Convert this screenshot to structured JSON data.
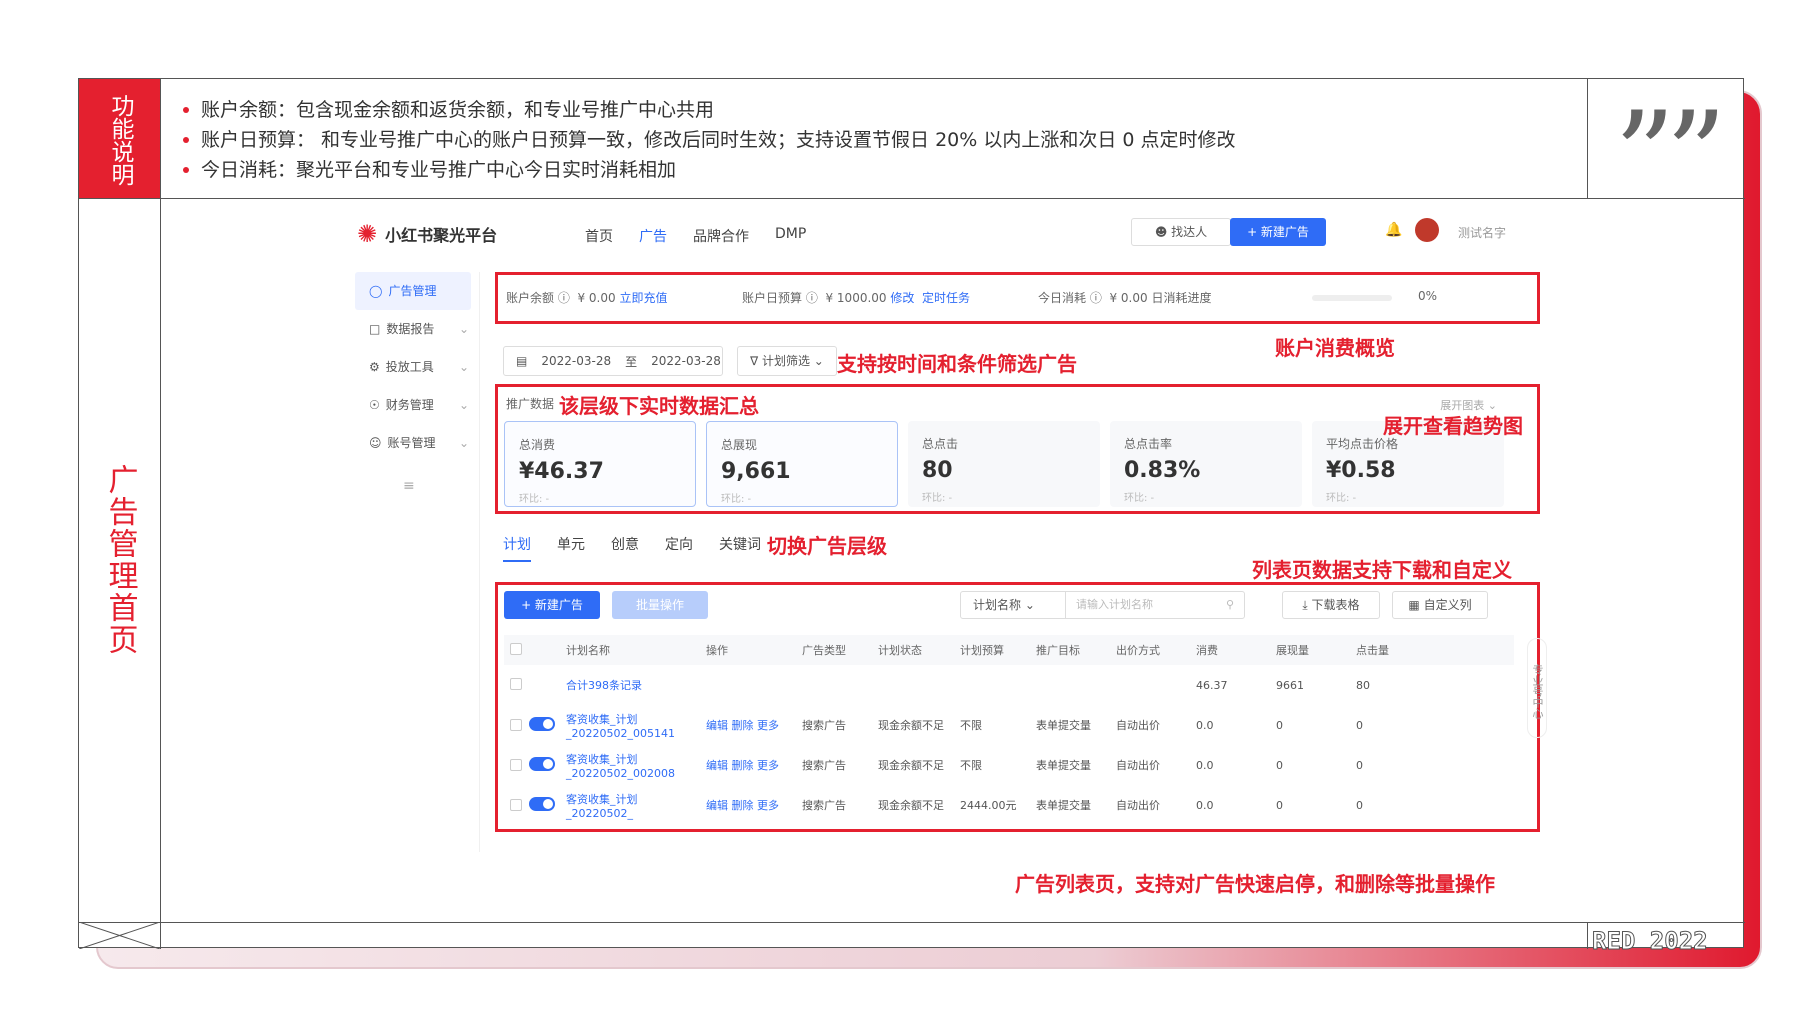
{
  "header": {
    "section_label": "功能说明",
    "bullets": [
      "账户余额：包含现金余额和返货余额，和专业号推广中心共用",
      "账户日预算：  和专业号推广中心的账户日预算一致，修改后同时生效；支持设置节假日 20% 以内上涨和次日 0 点定时修改",
      "今日消耗：聚光平台和专业号推广中心今日实时消耗相加"
    ]
  },
  "side_title": "广告管理首页",
  "footer_tag": "RED 2022",
  "annotations": {
    "overview": "账户消费概览",
    "filter": "支持按时间和条件筛选广告",
    "summary": "该层级下实时数据汇总",
    "trend": "展开查看趋势图",
    "level": "切换广告层级",
    "list_dl": "列表页数据支持下载和自定义",
    "list_ops": "广告列表页，支持对广告快速启停，和删除等批量操作"
  },
  "app": {
    "brand": "小红书聚光平台",
    "nav": [
      "首页",
      "广告",
      "品牌合作",
      "DMP"
    ],
    "find_btn": "找达人",
    "new_btn": "+ 新建广告",
    "user": "测试名字",
    "sidebar": [
      "广告管理",
      "数据报告",
      "投放工具",
      "财务管理",
      "账号管理"
    ],
    "overview": {
      "balance_label": "账户余额",
      "balance": "¥ 0.00",
      "recharge": "立即充值",
      "budget_label": "账户日预算",
      "budget": "¥ 1000.00",
      "modify": "修改",
      "timed": "定时任务",
      "today_label": "今日消耗",
      "today": "¥ 0.00",
      "progress_label": "日消耗进度",
      "progress_pct": "0%"
    },
    "filter": {
      "date_from": "2022-03-28",
      "to": "至",
      "date_to": "2022-03-28",
      "plan_filter": "计划筛选"
    },
    "stats": {
      "label": "推广数据",
      "expand": "展开图表",
      "cards": [
        {
          "title": "总消费",
          "value": "¥46.37",
          "sub": "环比: -"
        },
        {
          "title": "总展现",
          "value": "9,661",
          "sub": "环比: -"
        },
        {
          "title": "总点击",
          "value": "80",
          "sub": "环比: -"
        },
        {
          "title": "总点击率",
          "value": "0.83%",
          "sub": "环比: -"
        },
        {
          "title": "平均点击价格",
          "value": "¥0.58",
          "sub": "环比: -"
        }
      ]
    },
    "tabs": [
      "计划",
      "单元",
      "创意",
      "定向",
      "关键词"
    ],
    "table": {
      "new": "+ 新建广告",
      "batch": "批量操作",
      "select": "计划名称",
      "search_ph": "请输入计划名称",
      "download": "下载表格",
      "customize": "自定义列",
      "headers": [
        "计划名称",
        "操作",
        "广告类型",
        "计划状态",
        "计划预算",
        "推广目标",
        "出价方式",
        "消费",
        "展现量",
        "点击量"
      ],
      "total_row": {
        "name": "合计398条记录",
        "spend": "46.37",
        "impr": "9661",
        "clicks": "80"
      },
      "rows": [
        {
          "name": "客资收集_计划_20220502_005141",
          "ops": "编辑 删除 更多",
          "type": "搜索广告",
          "status": "现金余额不足",
          "budget": "不限",
          "goal": "表单提交量",
          "bid": "自动出价",
          "spend": "0.0",
          "impr": "0",
          "clicks": "0"
        },
        {
          "name": "客资收集_计划_20220502_002008",
          "ops": "编辑 删除 更多",
          "type": "搜索广告",
          "status": "现金余额不足",
          "budget": "不限",
          "goal": "表单提交量",
          "bid": "自动出价",
          "spend": "0.0",
          "impr": "0",
          "clicks": "0"
        },
        {
          "name": "客资收集_计划_20220502_",
          "ops": "编辑 删除 更多",
          "type": "搜索广告",
          "status": "现金余额不足",
          "budget": "2444.00元",
          "goal": "表单提交量",
          "bid": "自动出价",
          "spend": "0.0",
          "impr": "0",
          "clicks": "0"
        }
      ]
    },
    "pro_center": "专业号中心"
  }
}
